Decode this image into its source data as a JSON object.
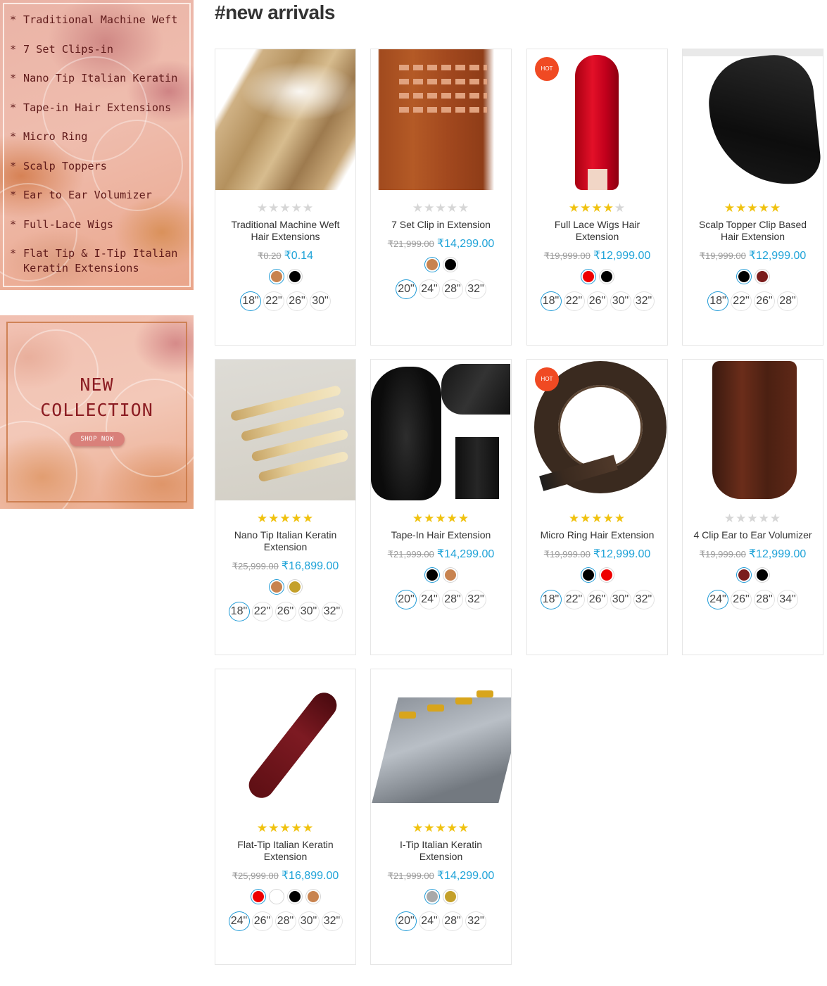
{
  "sidebar": {
    "categories": [
      {
        "label": "Traditional Machine Weft"
      },
      {
        "label": "7 Set Clips-in"
      },
      {
        "label": "Nano Tip Italian Keratin"
      },
      {
        "label": "Tape-in Hair Extensions"
      },
      {
        "label": "Micro Ring"
      },
      {
        "label": "Scalp Toppers"
      },
      {
        "label": "Ear to Ear Volumizer"
      },
      {
        "label": "Full-Lace Wigs"
      },
      {
        "label": "Flat Tip & I-Tip Italian Keratin Extensions"
      }
    ],
    "bullet": "*",
    "promo": {
      "line1": "NEW",
      "line2": "COLLECTION",
      "button": "SHOP NOW"
    }
  },
  "section_title": "#new arrivals",
  "hot_label": "HOT",
  "products": [
    {
      "name": "Traditional Machine Weft Hair Extensions",
      "rating": 0,
      "old_price": "₹0.20",
      "price": "₹0.14",
      "hot": false,
      "swatches": [
        "#c8834f",
        "#000000"
      ],
      "selected_swatch": 0,
      "sizes": [
        "18\"",
        "22\"",
        "26\"",
        "30\""
      ],
      "selected_size": 0
    },
    {
      "name": "7 Set Clip in Extension",
      "rating": 0,
      "old_price": "₹21,999.00",
      "price": "₹14,299.00",
      "hot": false,
      "swatches": [
        "#c8834f",
        "#000000"
      ],
      "selected_swatch": 0,
      "sizes": [
        "20\"",
        "24\"",
        "28\"",
        "32\""
      ],
      "selected_size": 0
    },
    {
      "name": "Full Lace Wigs Hair Extension",
      "rating": 4,
      "old_price": "₹19,999.00",
      "price": "₹12,999.00",
      "hot": true,
      "swatches": [
        "#ee0000",
        "#000000"
      ],
      "selected_swatch": 0,
      "sizes": [
        "18\"",
        "22\"",
        "26\"",
        "30\"",
        "32\""
      ],
      "selected_size": 0
    },
    {
      "name": "Scalp Topper Clip Based Hair Extension",
      "rating": 5,
      "old_price": "₹19,999.00",
      "price": "₹12,999.00",
      "hot": false,
      "swatches": [
        "#000000",
        "#7a1c1c"
      ],
      "selected_swatch": 0,
      "sizes": [
        "18\"",
        "22\"",
        "26\"",
        "28\""
      ],
      "selected_size": 0
    },
    {
      "name": "Nano Tip Italian Keratin Extension",
      "rating": 5,
      "old_price": "₹25,999.00",
      "price": "₹16,899.00",
      "hot": false,
      "swatches": [
        "#c8834f",
        "#c4a02a"
      ],
      "selected_swatch": 0,
      "sizes": [
        "18\"",
        "22\"",
        "26\"",
        "30\"",
        "32\""
      ],
      "selected_size": 0
    },
    {
      "name": "Tape-In Hair Extension",
      "rating": 5,
      "old_price": "₹21,999.00",
      "price": "₹14,299.00",
      "hot": false,
      "swatches": [
        "#000000",
        "#c8834f"
      ],
      "selected_swatch": 0,
      "sizes": [
        "20\"",
        "24\"",
        "28\"",
        "32\""
      ],
      "selected_size": 0
    },
    {
      "name": "Micro Ring Hair Extension",
      "rating": 5,
      "old_price": "₹19,999.00",
      "price": "₹12,999.00",
      "hot": true,
      "swatches": [
        "#000000",
        "#ee0000"
      ],
      "selected_swatch": 0,
      "sizes": [
        "18\"",
        "22\"",
        "26\"",
        "30\"",
        "32\""
      ],
      "selected_size": 0
    },
    {
      "name": "4 Clip Ear to Ear Volumizer",
      "rating": 0,
      "old_price": "₹19,999.00",
      "price": "₹12,999.00",
      "hot": false,
      "swatches": [
        "#7a1c1c",
        "#000000"
      ],
      "selected_swatch": 0,
      "sizes": [
        "24\"",
        "26\"",
        "28\"",
        "34\""
      ],
      "selected_size": 0
    },
    {
      "name": "Flat-Tip Italian Keratin Extension",
      "rating": 5,
      "old_price": "₹25,999.00",
      "price": "₹16,899.00",
      "hot": false,
      "swatches": [
        "#ee0000",
        "#ffffff",
        "#000000",
        "#c8834f"
      ],
      "selected_swatch": 0,
      "sizes": [
        "24\"",
        "26\"",
        "28\"",
        "30\"",
        "32\""
      ],
      "selected_size": 0
    },
    {
      "name": "I-Tip Italian Keratin Extension",
      "rating": 5,
      "old_price": "₹21,999.00",
      "price": "₹14,299.00",
      "hot": false,
      "swatches": [
        "#a9a9a9",
        "#c4a02a"
      ],
      "selected_swatch": 0,
      "sizes": [
        "20\"",
        "24\"",
        "28\"",
        "32\""
      ],
      "selected_size": 0
    }
  ],
  "colors": {
    "price_accent": "#1fa3d8",
    "star_on": "#f0c20f",
    "star_off": "#d6d6d6",
    "hot_badge": "#f04a23",
    "selected_ring": "#1f9ad6"
  }
}
